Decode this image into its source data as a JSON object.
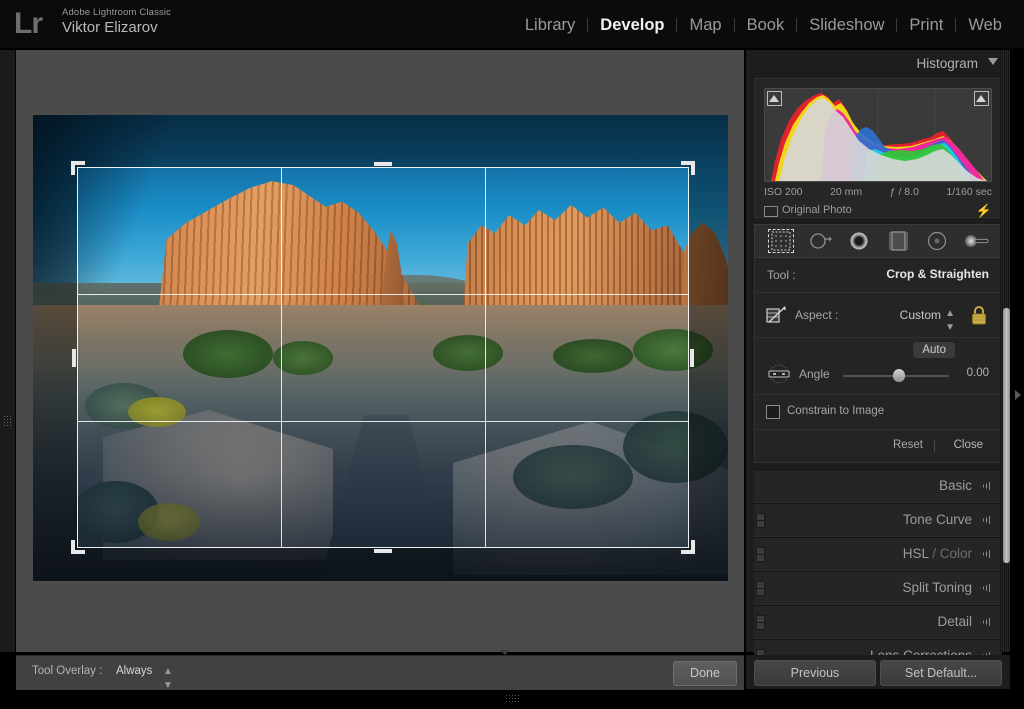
{
  "app": {
    "logo_text": "Lr",
    "product_name": "Adobe Lightroom Classic",
    "user_name": "Viktor Elizarov"
  },
  "modules": [
    {
      "label": "Library",
      "active": false
    },
    {
      "label": "Develop",
      "active": true
    },
    {
      "label": "Map",
      "active": false
    },
    {
      "label": "Book",
      "active": false
    },
    {
      "label": "Slideshow",
      "active": false
    },
    {
      "label": "Print",
      "active": false
    },
    {
      "label": "Web",
      "active": false
    }
  ],
  "histogram": {
    "title": "Histogram",
    "caret_icon": "chevron-down-icon",
    "shadow_clip_icon": "shadow-clipping-triangle",
    "highlight_clip_icon": "highlight-clipping-triangle",
    "exif": {
      "iso": "ISO 200",
      "focal_length": "20 mm",
      "aperture": "ƒ / 8.0",
      "shutter": "1/160 sec"
    },
    "original_photo_label": "Original Photo",
    "original_photo_icon": "rectangle-icon",
    "flash_icon": "lightning-bolt-icon"
  },
  "tool_strip": [
    {
      "name": "crop-overlay-tool",
      "selected": true
    },
    {
      "name": "spot-removal-tool",
      "selected": false
    },
    {
      "name": "red-eye-correction-tool",
      "selected": false
    },
    {
      "name": "graduated-filter-tool",
      "selected": false
    },
    {
      "name": "radial-filter-tool",
      "selected": false
    },
    {
      "name": "adjustment-brush-tool",
      "selected": false
    }
  ],
  "crop_panel": {
    "tool_label": "Tool :",
    "tool_value": "Crop & Straighten",
    "aspect_label": "Aspect :",
    "aspect_value": "Custom",
    "aspect_icon": "crop-frame-icon",
    "lock_icon": "padlock-icon",
    "lock_color": "#c9a83c",
    "auto_label": "Auto",
    "angle_label": "Angle",
    "angle_value": "0.00",
    "angle_icon": "angle-dial-icon",
    "constrain_label": "Constrain to Image",
    "constrain_checked": false,
    "reset_label": "Reset",
    "close_label": "Close"
  },
  "sections": [
    {
      "label": "Basic",
      "dim_suffix": "",
      "has_switch": false
    },
    {
      "label": "Tone Curve",
      "dim_suffix": "",
      "has_switch": true
    },
    {
      "label": "HSL",
      "dim_suffix": " / Color",
      "has_switch": true
    },
    {
      "label": "Split Toning",
      "dim_suffix": "",
      "has_switch": true
    },
    {
      "label": "Detail",
      "dim_suffix": "",
      "has_switch": true
    },
    {
      "label": "Lens Corrections",
      "dim_suffix": "",
      "has_switch": true
    }
  ],
  "toolbar": {
    "tool_overlay_label": "Tool Overlay :",
    "tool_overlay_value": "Always",
    "done_label": "Done"
  },
  "bottom_buttons": {
    "previous_label": "Previous",
    "set_default_label": "Set Default..."
  },
  "photo": {
    "alt": "Cathedral Valley sandstone buttes at sunrise, Capitol Reef",
    "crop_grid": "rule-of-thirds"
  },
  "colors": {
    "accent_lock": "#c9a83c",
    "panel_bg": "#1d1d1d",
    "center_bg": "#4b4b4b",
    "topbar_bg": "#0b0b0b"
  }
}
